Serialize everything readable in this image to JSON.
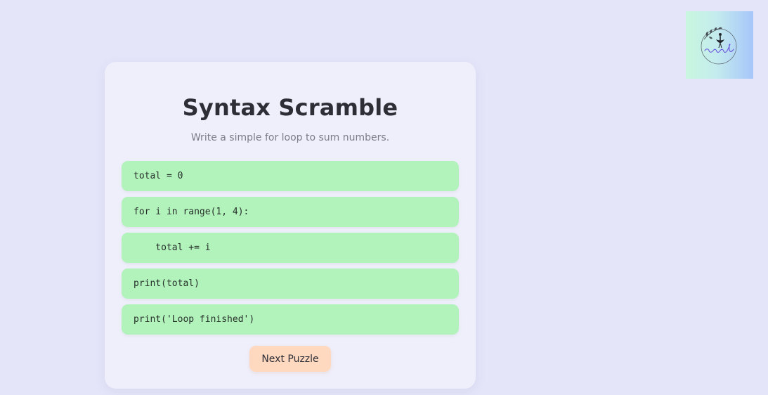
{
  "app": {
    "title": "Syntax Scramble",
    "subtitle": "Write a simple for loop to sum numbers."
  },
  "code_blocks": [
    {
      "text": "total = 0"
    },
    {
      "text": "for i in range(1, 4):"
    },
    {
      "text": "    total += i"
    },
    {
      "text": "print(total)"
    },
    {
      "text": "print('Loop finished')"
    }
  ],
  "buttons": {
    "next_label": "Next Puzzle"
  },
  "logo": {
    "signature": "samruddhi"
  },
  "colors": {
    "page_background": "#e4e5f9",
    "card_background": "#efeffb",
    "block_green": "#b2f2bb",
    "button_peach": "#ffd8c0",
    "title_text": "#2e2e36",
    "subtitle_text": "#7c7c86"
  }
}
